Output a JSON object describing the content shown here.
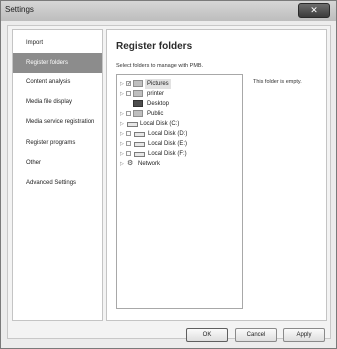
{
  "window": {
    "title": "Settings",
    "close_glyph": "✕"
  },
  "sidebar": {
    "items": [
      {
        "label": "Import",
        "active": false
      },
      {
        "label": "Register folders",
        "active": true
      },
      {
        "label": "Content analysis",
        "active": false
      },
      {
        "label": "Media file display",
        "active": false
      },
      {
        "label": "Media service registration",
        "active": false
      },
      {
        "label": "Register programs",
        "active": false
      },
      {
        "label": "Other",
        "active": false
      },
      {
        "label": "Advanced Settings",
        "active": false
      }
    ]
  },
  "main": {
    "heading": "Register folders",
    "instruction": "Select folders to manage with PMB.",
    "empty_note": "This folder is empty.",
    "tree": [
      {
        "label": "Pictures",
        "icon": "folder-icon",
        "checked": true,
        "selected": true
      },
      {
        "label": "printer",
        "icon": "folder-icon",
        "checked": false
      },
      {
        "label": "Desktop",
        "icon": "folder-icon"
      },
      {
        "label": "Public",
        "icon": "folder-icon",
        "checked": false
      },
      {
        "label": "Local Disk (C:)",
        "icon": "disk-icon"
      },
      {
        "label": "Local Disk (D:)",
        "icon": "disk-icon",
        "checked": false
      },
      {
        "label": "Local Disk (E:)",
        "icon": "disk-icon",
        "checked": false
      },
      {
        "label": "Local Disk (F:)",
        "icon": "disk-icon",
        "checked": false
      },
      {
        "label": "Network",
        "icon": "network-icon"
      }
    ]
  },
  "buttons": {
    "ok": "OK",
    "cancel": "Cancel",
    "apply": "Apply"
  }
}
